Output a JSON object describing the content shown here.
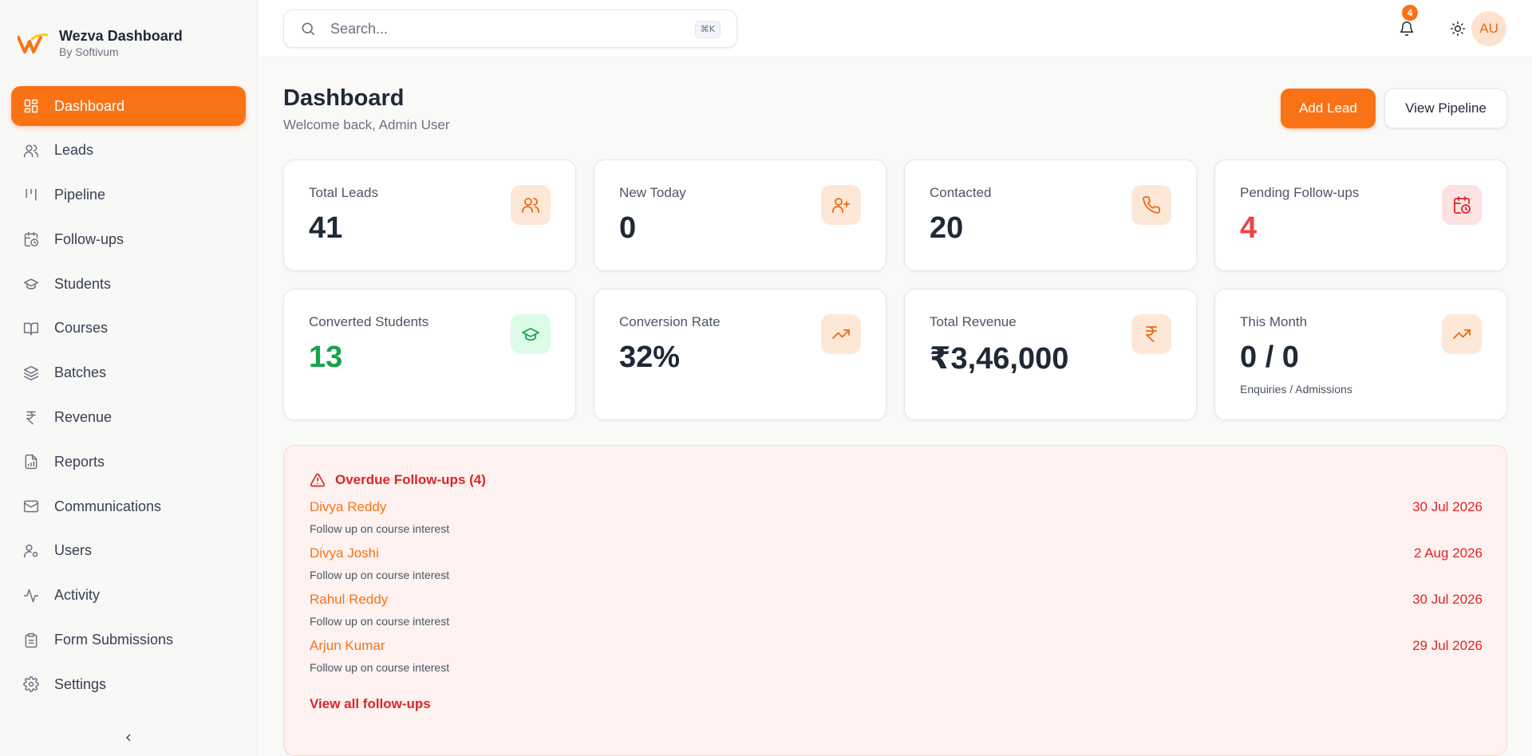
{
  "brand": {
    "title": "Wezva Dashboard",
    "subtitle": "By Softivum"
  },
  "sidebar": {
    "items": [
      {
        "label": "Dashboard",
        "icon": "dashboard-icon",
        "active": true
      },
      {
        "label": "Leads",
        "icon": "users-icon"
      },
      {
        "label": "Pipeline",
        "icon": "pipeline-icon"
      },
      {
        "label": "Follow-ups",
        "icon": "calendar-clock-icon"
      },
      {
        "label": "Students",
        "icon": "graduation-cap-icon"
      },
      {
        "label": "Courses",
        "icon": "book-icon"
      },
      {
        "label": "Batches",
        "icon": "layers-icon"
      },
      {
        "label": "Revenue",
        "icon": "rupee-icon"
      },
      {
        "label": "Reports",
        "icon": "report-icon"
      },
      {
        "label": "Communications",
        "icon": "mail-icon"
      },
      {
        "label": "Users",
        "icon": "user-cog-icon"
      },
      {
        "label": "Activity",
        "icon": "activity-icon"
      },
      {
        "label": "Form Submissions",
        "icon": "clipboard-icon"
      },
      {
        "label": "Settings",
        "icon": "gear-icon"
      }
    ]
  },
  "topbar": {
    "search_placeholder": "Search...",
    "search_shortcut": "⌘K",
    "notification_count": "4",
    "avatar_initials": "AU"
  },
  "header": {
    "title": "Dashboard",
    "subtitle": "Welcome back, Admin User",
    "add_lead_label": "Add Lead",
    "view_pipeline_label": "View Pipeline"
  },
  "stats": [
    {
      "label": "Total Leads",
      "value": "41",
      "icon": "users-icon"
    },
    {
      "label": "New Today",
      "value": "0",
      "icon": "user-plus-icon"
    },
    {
      "label": "Contacted",
      "value": "20",
      "icon": "phone-icon"
    },
    {
      "label": "Pending Follow-ups",
      "value": "4",
      "icon": "calendar-clock-icon"
    },
    {
      "label": "Converted Students",
      "value": "13",
      "icon": "graduation-cap-icon"
    },
    {
      "label": "Conversion Rate",
      "value": "32%",
      "icon": "trending-up-icon"
    },
    {
      "label": "Total Revenue",
      "value": "₹3,46,000",
      "icon": "rupee-icon"
    },
    {
      "label": "This Month",
      "value": "0 / 0",
      "note": "Enquiries / Admissions",
      "icon": "trending-up-icon"
    }
  ],
  "colors": {
    "accent": "#f97316",
    "danger": "#dc2626",
    "success": "#16a34a"
  },
  "overdue": {
    "title": "Overdue Follow-ups (4)",
    "items": [
      {
        "name": "Divya Reddy",
        "note": "Follow up on course interest",
        "date": "30 Jul 2026"
      },
      {
        "name": "Divya Joshi",
        "note": "Follow up on course interest",
        "date": "2 Aug 2026"
      },
      {
        "name": "Rahul Reddy",
        "note": "Follow up on course interest",
        "date": "30 Jul 2026"
      },
      {
        "name": "Arjun Kumar",
        "note": "Follow up on course interest",
        "date": "29 Jul 2026"
      }
    ],
    "view_all_label": "View all follow-ups"
  }
}
